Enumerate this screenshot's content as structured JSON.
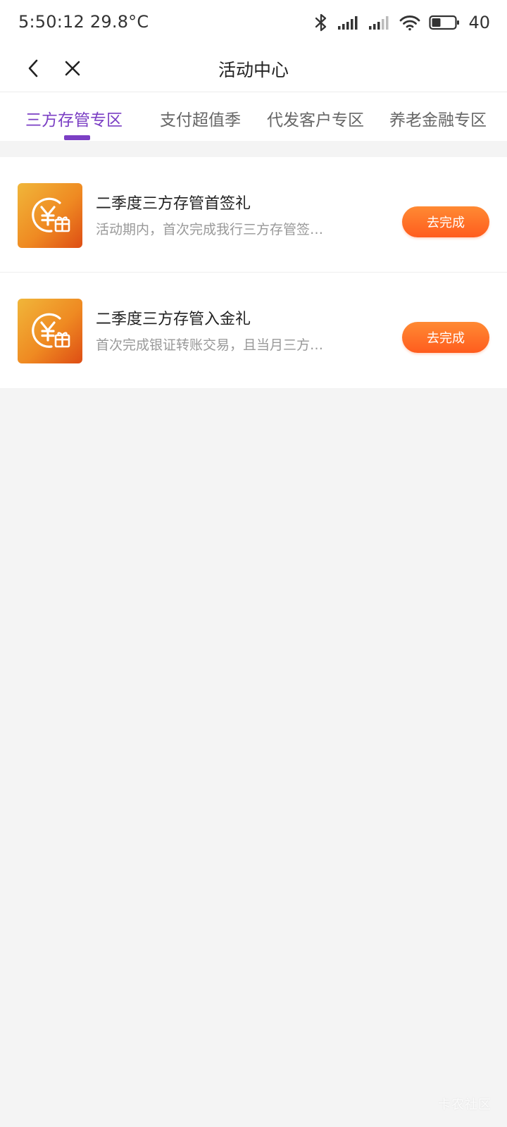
{
  "status_bar": {
    "time": "5:50:12",
    "temperature": "29.8°C",
    "battery_level": "40",
    "icons": [
      "bluetooth-icon",
      "signal-icon",
      "signal-icon",
      "wifi-icon",
      "battery-icon"
    ]
  },
  "header": {
    "title": "活动中心",
    "back_icon": "chevron-left-icon",
    "close_icon": "close-icon"
  },
  "tabs": [
    {
      "label": "三方存管专区",
      "active": true
    },
    {
      "label": "支付超值季",
      "active": false
    },
    {
      "label": "代发客户专区",
      "active": false
    },
    {
      "label": "养老金融专区",
      "active": false
    }
  ],
  "activities": [
    {
      "title": "二季度三方存管首签礼",
      "description": "活动期内，首次完成我行三方存管签约…",
      "button_label": "去完成",
      "icon": "yuan-gift-icon"
    },
    {
      "title": "二季度三方存管入金礼",
      "description": "首次完成银证转账交易，且当月三方保…",
      "button_label": "去完成",
      "icon": "yuan-gift-icon"
    }
  ],
  "watermark": "卡农社区",
  "colors": {
    "accent": "#7b3fc4",
    "button": "#ff6a24",
    "background": "#f4f4f4"
  }
}
